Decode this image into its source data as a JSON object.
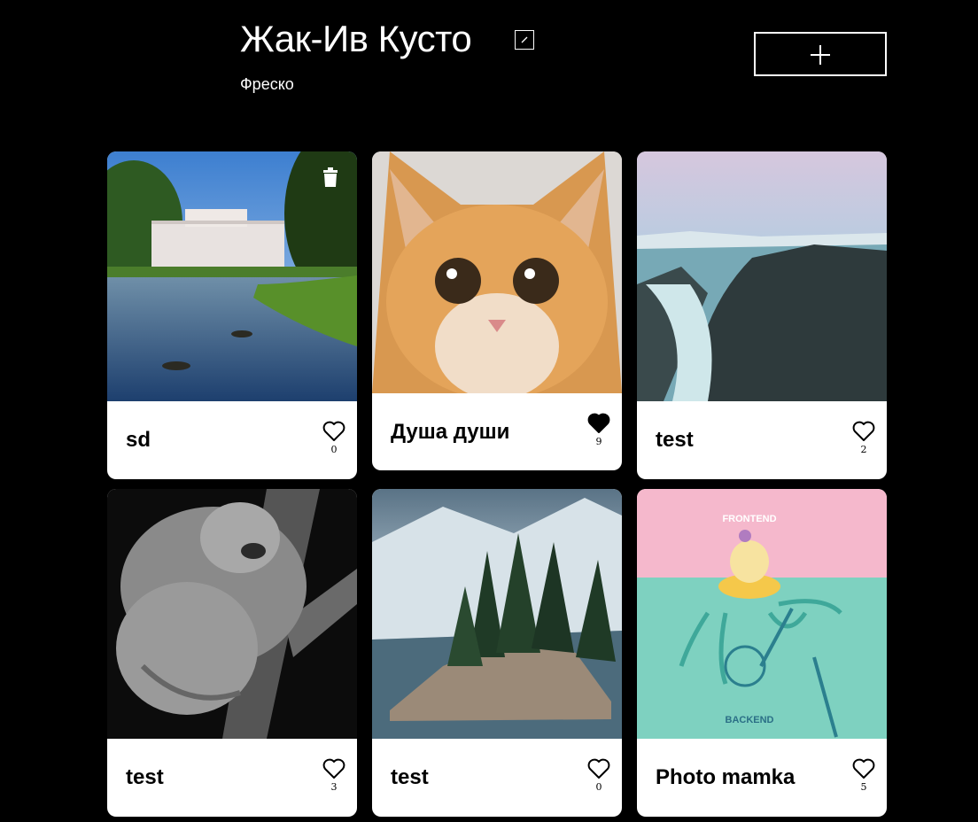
{
  "profile": {
    "name": "Жак-Ив Кусто",
    "about": "Фреско"
  },
  "cards": [
    {
      "title": "sd",
      "likes": "0",
      "liked": false,
      "image": "palace-with-lake-and-ducks"
    },
    {
      "title": "Душа души",
      "likes": "9",
      "liked": true,
      "image": "ginger-kitten"
    },
    {
      "title": "test",
      "likes": "2",
      "liked": false,
      "image": "rocky-cliff-frozen-river"
    },
    {
      "title": "test",
      "likes": "3",
      "liked": false,
      "image": "koala-on-tree-bw"
    },
    {
      "title": "test",
      "likes": "0",
      "liked": false,
      "image": "forested-rock-island"
    },
    {
      "title": "Photo mamka",
      "likes": "5",
      "liked": false,
      "image": "frontend-backend-illustration"
    }
  ],
  "icons": {
    "edit": "pencil-icon",
    "add": "plus-icon",
    "like": "heart-icon",
    "delete": "trash-icon"
  },
  "image_text": {
    "frontend": "FRONTEND",
    "backend": "BACKEND"
  }
}
